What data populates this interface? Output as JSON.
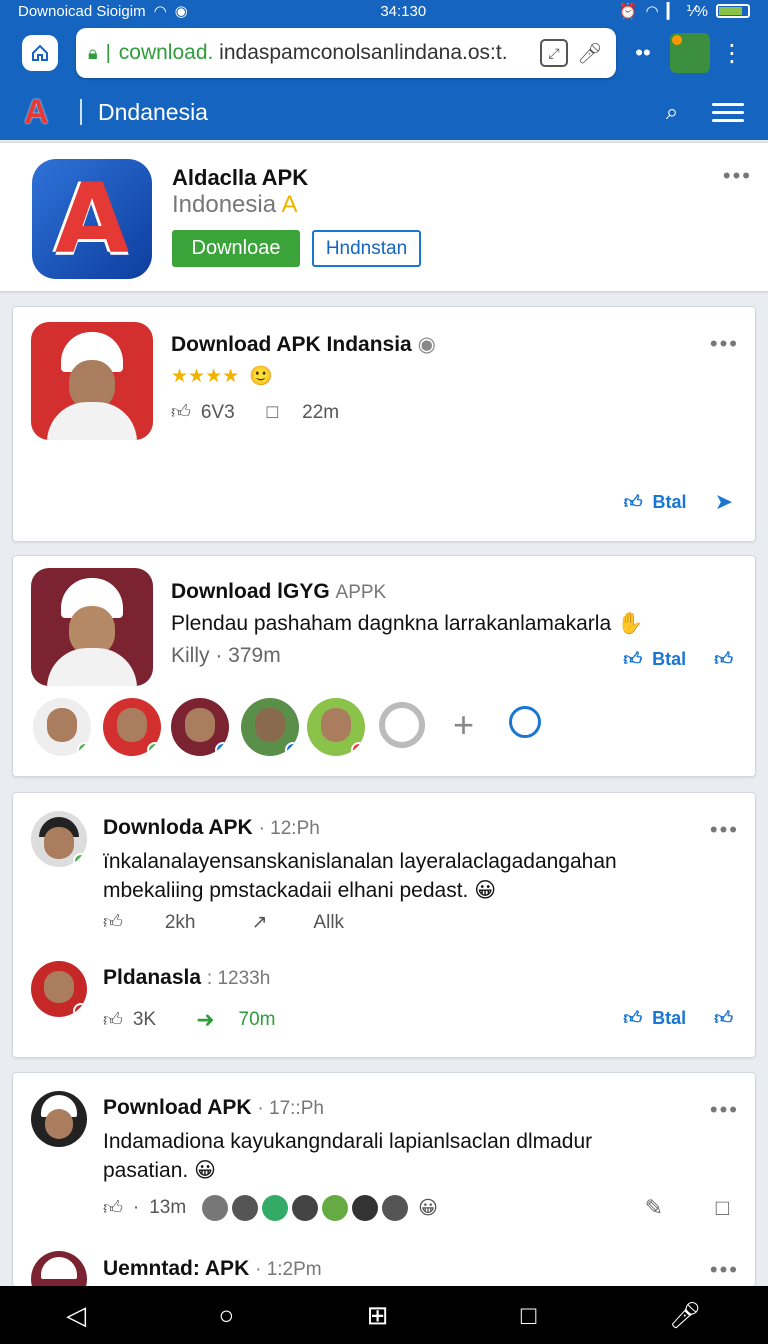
{
  "status": {
    "left_text": "Downoicad Sioigim",
    "time": "34:130",
    "pct": "⅟%",
    "battery_level": 0.85
  },
  "browser": {
    "url_main": "cownload.",
    "url_rest": " indaspamconolsanlindana.os:t."
  },
  "appbar": {
    "title": "Dndanesia"
  },
  "app": {
    "name": "Aldaclla APK",
    "subtitle": "Indonesia",
    "download_label": "Downloae",
    "secondary_label": "Hndnstan"
  },
  "post1": {
    "title": "Download APK Indansia",
    "rating": "★★★★",
    "likes": "6V3",
    "comments": "22m",
    "action": "Btal"
  },
  "post2": {
    "title_bold": "Download lGYG",
    "title_tag": "APPK",
    "body": "Plendau pashaham dagnkna larrakanlamakarla",
    "meta": "Killy · 379m",
    "action": "Btal"
  },
  "comment1": {
    "author": "Downloda APK",
    "time": "12:Ph",
    "body": "ïnkalanalayensanskanislanalan layeralaclagadangahan mbekaliing pmstackadaii elhani pedast.",
    "likes": "2kh",
    "shares": "Allk"
  },
  "comment2": {
    "author": "Pldanasla",
    "time": "1233h",
    "likes": "3K",
    "shares": "70m",
    "action": "Btal"
  },
  "comment3": {
    "author": "Pownload APK",
    "time": "17::Ph",
    "body": "Indamadiona kayukangndarali lapianlsaclan dlmadur pasatian.",
    "meta": "13m"
  },
  "comment4": {
    "author": "Uemntad: APK",
    "time": "1:2Pm"
  }
}
